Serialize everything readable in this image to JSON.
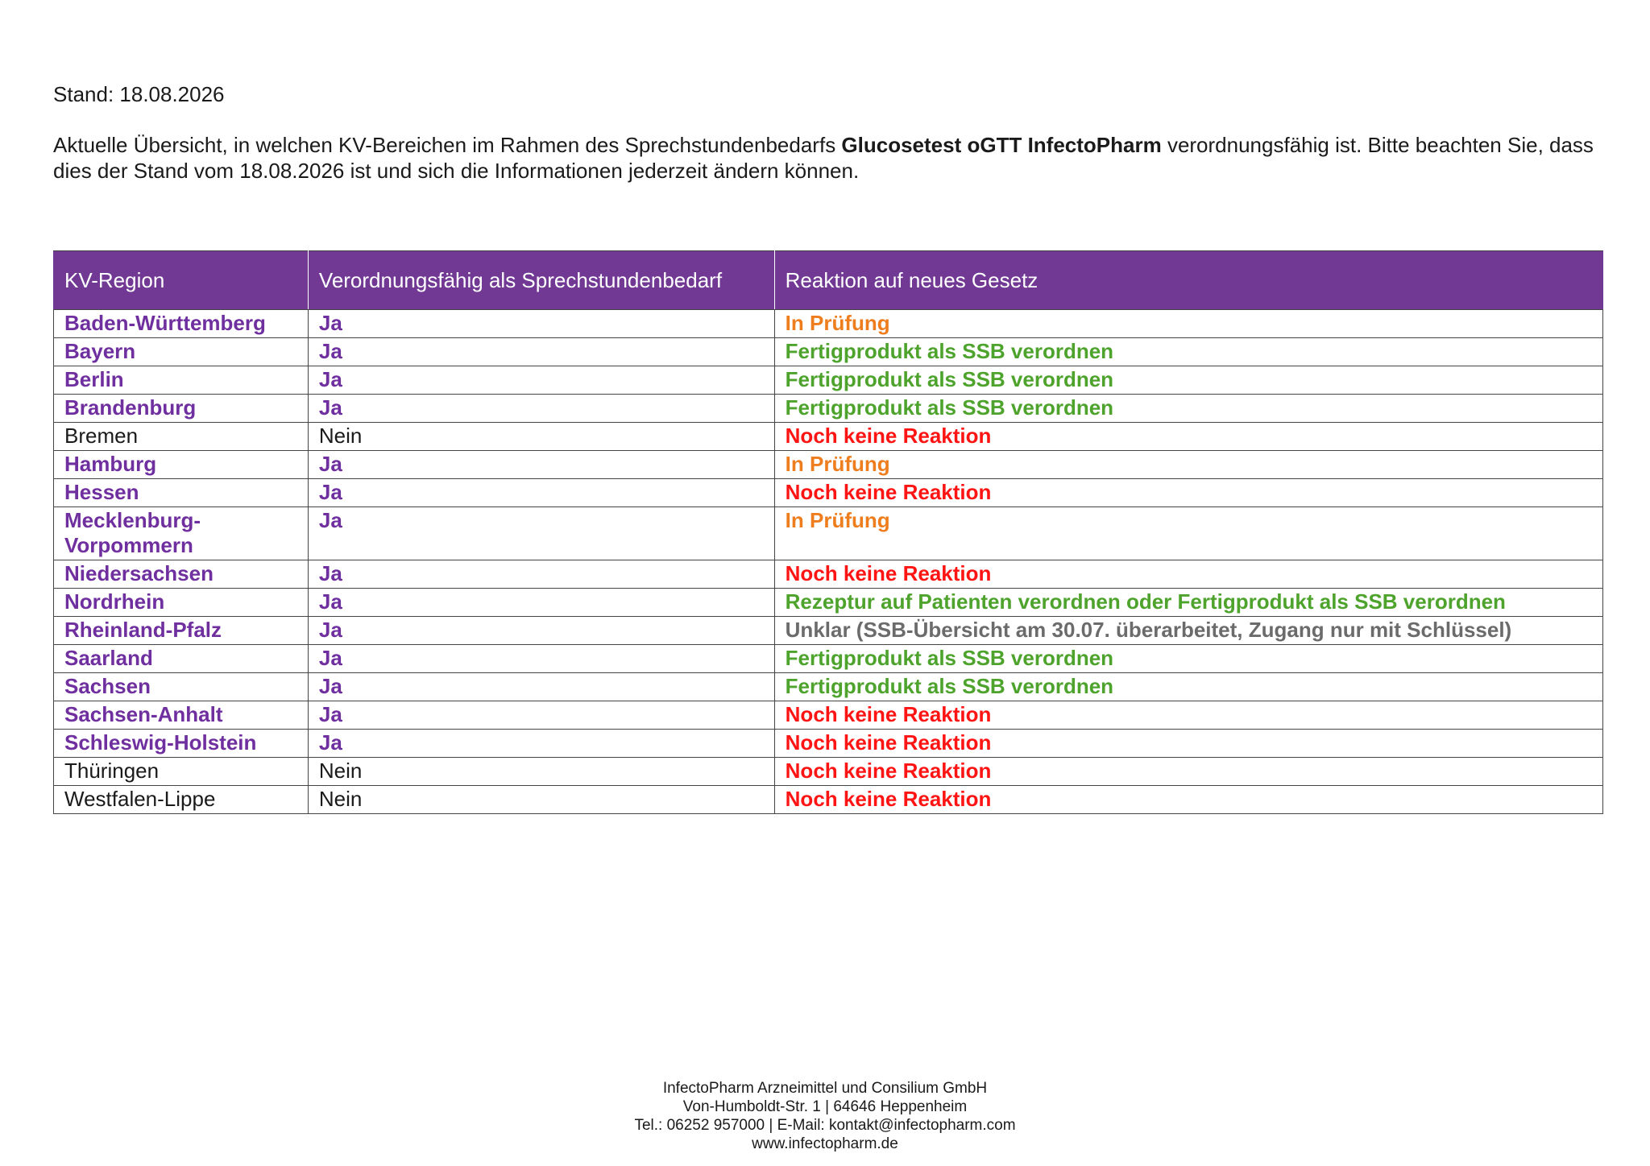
{
  "stand": "Stand: 18.08.2026",
  "intro": {
    "pre": "Aktuelle Übersicht, in welchen KV-Bereichen im Rahmen des Sprechstundenbedarfs ",
    "product": "Glucosetest oGTT InfectoPharm",
    "post": " verordnungsfähig ist. Bitte beachten Sie, dass dies der Stand vom 18.08.2026 ist und sich die Informationen jederzeit ändern können."
  },
  "table": {
    "headers": [
      "KV-Region",
      "Verordnungsfähig als Sprechstundenbedarf",
      "Reaktion auf neues Gesetz"
    ],
    "header_color": "#713994",
    "rows": [
      {
        "region": "Baden-Württemberg",
        "verordnungsfaehig": "Ja",
        "reaktion": "In Prüfung",
        "status": "orange"
      },
      {
        "region": "Bayern",
        "verordnungsfaehig": "Ja",
        "reaktion": "Fertigprodukt als SSB verordnen",
        "status": "green"
      },
      {
        "region": "Berlin",
        "verordnungsfaehig": "Ja",
        "reaktion": "Fertigprodukt als SSB verordnen",
        "status": "green"
      },
      {
        "region": "Brandenburg",
        "verordnungsfaehig": "Ja",
        "reaktion": "Fertigprodukt als SSB verordnen",
        "status": "green"
      },
      {
        "region": "Bremen",
        "verordnungsfaehig": "Nein",
        "reaktion": "Noch keine Reaktion",
        "status": "red"
      },
      {
        "region": "Hamburg",
        "verordnungsfaehig": "Ja",
        "reaktion": "In Prüfung",
        "status": "orange"
      },
      {
        "region": "Hessen",
        "verordnungsfaehig": "Ja",
        "reaktion": "Noch keine Reaktion",
        "status": "red"
      },
      {
        "region": "Mecklenburg-Vorpommern",
        "verordnungsfaehig": "Ja",
        "reaktion": "In Prüfung",
        "status": "orange"
      },
      {
        "region": "Niedersachsen",
        "verordnungsfaehig": "Ja",
        "reaktion": "Noch keine Reaktion",
        "status": "red"
      },
      {
        "region": "Nordrhein",
        "verordnungsfaehig": "Ja",
        "reaktion": "Rezeptur auf Patienten verordnen oder Fertigprodukt als SSB verordnen",
        "status": "green"
      },
      {
        "region": "Rheinland-Pfalz",
        "verordnungsfaehig": "Ja",
        "reaktion": "Unklar (SSB-Übersicht am 30.07. überarbeitet, Zugang nur mit Schlüssel)",
        "status": "gray"
      },
      {
        "region": "Saarland",
        "verordnungsfaehig": "Ja",
        "reaktion": "Fertigprodukt als SSB verordnen",
        "status": "green"
      },
      {
        "region": "Sachsen",
        "verordnungsfaehig": "Ja",
        "reaktion": "Fertigprodukt als SSB verordnen",
        "status": "green"
      },
      {
        "region": "Sachsen-Anhalt",
        "verordnungsfaehig": "Ja",
        "reaktion": "Noch keine Reaktion",
        "status": "red"
      },
      {
        "region": "Schleswig-Holstein",
        "verordnungsfaehig": "Ja",
        "reaktion": "Noch keine Reaktion",
        "status": "red"
      },
      {
        "region": "Thüringen",
        "verordnungsfaehig": "Nein",
        "reaktion": "Noch keine Reaktion",
        "status": "red"
      },
      {
        "region": "Westfalen-Lippe",
        "verordnungsfaehig": "Nein",
        "reaktion": "Noch keine Reaktion",
        "status": "red"
      }
    ]
  },
  "status_colors": {
    "orange": "#ee7d1e",
    "green": "#4da32c",
    "red": "#ff1414",
    "gray": "#6b6b6b",
    "purple": "#6f2f9f"
  },
  "footer": {
    "company": "InfectoPharm Arzneimittel und Consilium GmbH",
    "address": "Von-Humboldt-Str. 1 | 64646 Heppenheim",
    "contact": "Tel.: 06252 957000 | E-Mail: kontakt@infectopharm.com",
    "website": "www.infectopharm.de"
  }
}
